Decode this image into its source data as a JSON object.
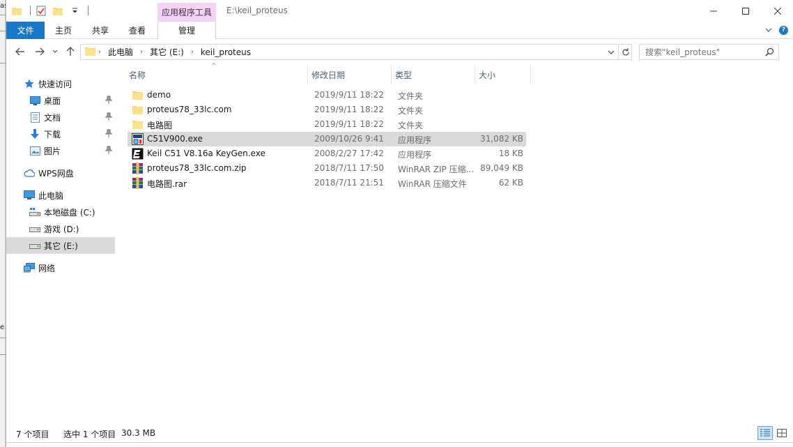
{
  "window": {
    "context_tab_header": "应用程序工具",
    "title_path": "E:\\keil_proteus"
  },
  "ribbon": {
    "tabs": [
      {
        "label": "文件"
      },
      {
        "label": "主页"
      },
      {
        "label": "共享"
      },
      {
        "label": "查看"
      },
      {
        "label": "管理"
      }
    ]
  },
  "address": {
    "crumbs": [
      "此电脑",
      "其它 (E:)",
      "keil_proteus"
    ]
  },
  "search": {
    "placeholder": "搜索\"keil_proteus\""
  },
  "nav": {
    "items": [
      {
        "label": "快速访问",
        "icon": "star-icon"
      },
      {
        "label": "桌面",
        "icon": "desktop-icon",
        "pinned": true
      },
      {
        "label": "文档",
        "icon": "document-icon",
        "pinned": true
      },
      {
        "label": "下载",
        "icon": "download-icon",
        "pinned": true
      },
      {
        "label": "图片",
        "icon": "pictures-icon",
        "pinned": true
      },
      {
        "label": "WPS网盘",
        "icon": "cloud-icon"
      },
      {
        "label": "此电脑",
        "icon": "computer-icon"
      },
      {
        "label": "本地磁盘 (C:)",
        "icon": "drive-icon"
      },
      {
        "label": "游戏 (D:)",
        "icon": "drive-icon"
      },
      {
        "label": "其它 (E:)",
        "icon": "drive-icon",
        "selected": true
      },
      {
        "label": "网络",
        "icon": "network-icon"
      }
    ]
  },
  "columns": {
    "name": "名称",
    "date": "修改日期",
    "type": "类型",
    "size": "大小"
  },
  "files": [
    {
      "name": "demo",
      "date": "2019/9/11 18:22",
      "type": "文件夹",
      "size": "",
      "icon": "folder-icon"
    },
    {
      "name": "proteus78_33lc.com",
      "date": "2019/9/11 18:22",
      "type": "文件夹",
      "size": "",
      "icon": "folder-icon"
    },
    {
      "name": "电路图",
      "date": "2019/9/11 18:22",
      "type": "文件夹",
      "size": "",
      "icon": "folder-icon"
    },
    {
      "name": "C51V900.exe",
      "date": "2009/10/26 9:41",
      "type": "应用程序",
      "size": "31,082 KB",
      "icon": "exe-installer-icon",
      "selected": true
    },
    {
      "name": "Keil C51 V8.16a KeyGen.exe",
      "date": "2008/2/27 17:42",
      "type": "应用程序",
      "size": "18 KB",
      "icon": "keygen-exe-icon"
    },
    {
      "name": "proteus78_33lc.com.zip",
      "date": "2018/7/11 17:50",
      "type": "WinRAR ZIP 压缩...",
      "size": "89,049 KB",
      "icon": "winrar-icon"
    },
    {
      "name": "电路图.rar",
      "date": "2018/7/11 21:51",
      "type": "WinRAR 压缩文件",
      "size": "62 KB",
      "icon": "winrar-icon"
    }
  ],
  "status": {
    "item_count": "7 个项目",
    "selected": "选中 1 个项目",
    "selected_size": "30.3 MB"
  },
  "background_window": {
    "fragments": [
      "as",
      "e"
    ]
  }
}
